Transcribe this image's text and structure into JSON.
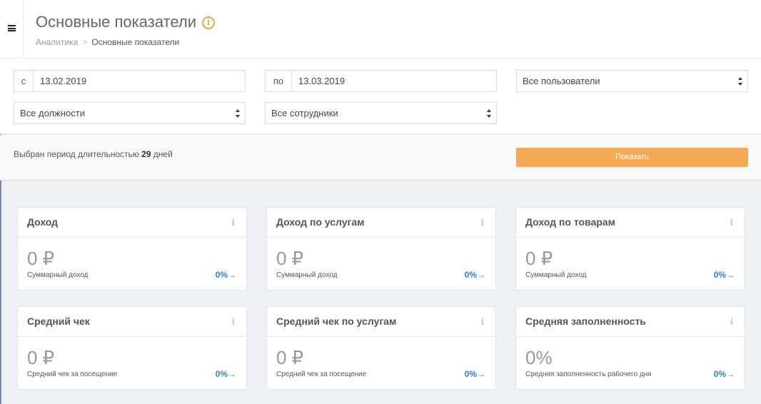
{
  "header": {
    "menu_icon": "hamburger-icon",
    "title": "Основные показатели",
    "info_icon": "info-circle-icon",
    "info_glyph": "i",
    "breadcrumb": [
      {
        "label": "Аналитика"
      },
      {
        "label": "Основные показатели"
      }
    ],
    "breadcrumb_separator": ">"
  },
  "filters": {
    "date_from": {
      "prefix": "с",
      "value": "13.02.2019"
    },
    "date_to": {
      "prefix": "по",
      "value": "13.03.2019"
    },
    "users_select": "Все пользователи",
    "positions_select": "Все должности",
    "employees_select": "Все сотрудники"
  },
  "period": {
    "text_before": "Выбран период длительностью ",
    "days": "29",
    "text_after": " дней",
    "show_button": "Показать"
  },
  "colors": {
    "accent": "#f7ab56",
    "link": "#2f7ebe",
    "info_icon": "#f2a33a"
  },
  "cards": [
    {
      "title": "Доход",
      "info": "i",
      "value": "0 ₽",
      "subtitle": "Суммарный доход",
      "percent": "0%",
      "arrow": "→"
    },
    {
      "title": "Доход по услугам",
      "info": "i",
      "value": "0 ₽",
      "subtitle": "Суммарный доход",
      "percent": "0%",
      "arrow": "→"
    },
    {
      "title": "Доход по товарам",
      "info": "i",
      "value": "0 ₽",
      "subtitle": "Суммарный доход",
      "percent": "0%",
      "arrow": "→"
    },
    {
      "title": "Средний чек",
      "info": "i",
      "value": "0 ₽",
      "subtitle": "Средний чек за посещение",
      "percent": "0%",
      "arrow": "→"
    },
    {
      "title": "Средний чек по услугам",
      "info": "i",
      "value": "0 ₽",
      "subtitle": "Средний чек за посещение",
      "percent": "0%",
      "arrow": "→"
    },
    {
      "title": "Средняя заполненность",
      "info": "i",
      "value": "0%",
      "subtitle": "Средняя заполненность рабочего дня",
      "percent": "0%",
      "arrow": "→"
    }
  ]
}
